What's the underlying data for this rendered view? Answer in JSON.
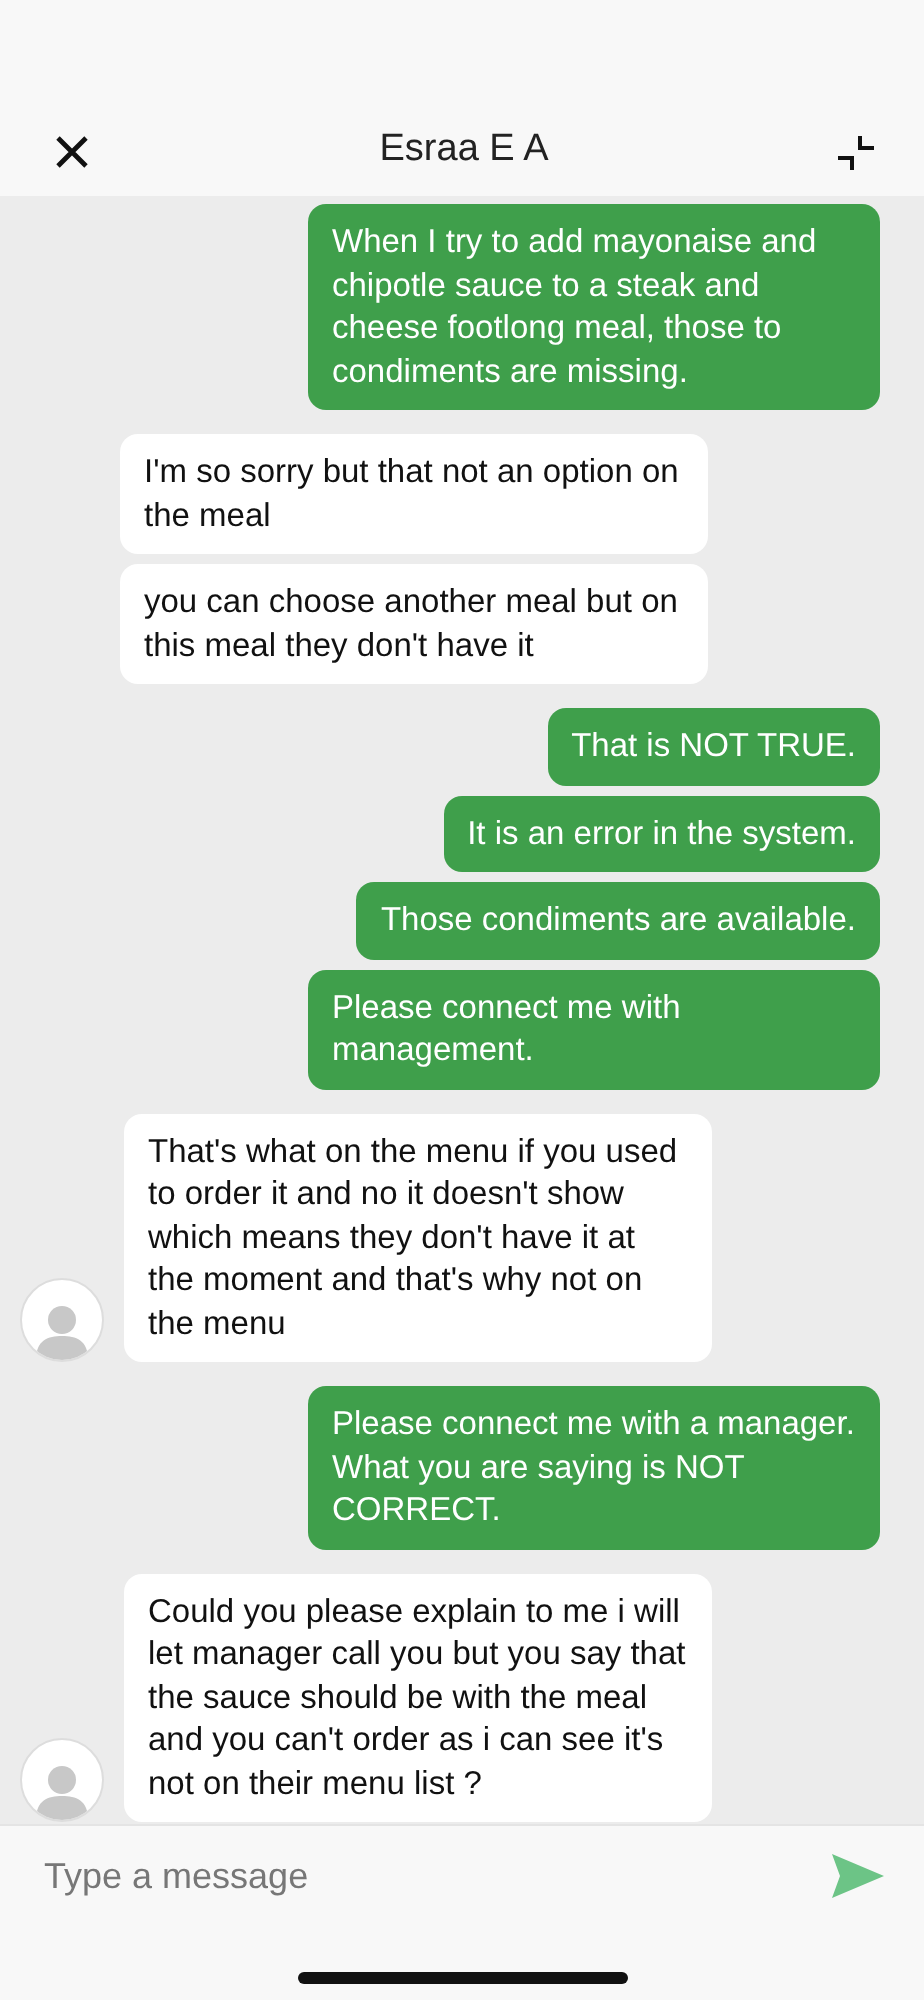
{
  "header": {
    "title": "Esraa E A"
  },
  "groups": [
    {
      "kind": "me",
      "avatar": false,
      "messages": [
        "When I try to add mayonaise and chipotle sauce to a steak and cheese footlong meal, those to condiments are missing."
      ]
    },
    {
      "kind": "agent",
      "avatar": false,
      "messages": [
        "I'm so sorry but that not an option on the meal",
        "you can choose another meal but on this meal they don't have it"
      ]
    },
    {
      "kind": "me",
      "avatar": false,
      "messages": [
        "That is NOT TRUE.",
        "It is an error in the system.",
        "Those condiments are available.",
        "Please connect me with management."
      ]
    },
    {
      "kind": "agent",
      "avatar": true,
      "messages": [
        "That's what on the menu if you used to order it and no it doesn't show which means they don't have it at the moment and that's why not on the menu"
      ]
    },
    {
      "kind": "me",
      "avatar": false,
      "messages": [
        "Please connect me with a manager. What you are saying is NOT CORRECT."
      ]
    },
    {
      "kind": "agent",
      "avatar": true,
      "messages": [
        "Could you please explain to me i will let manager call you but you say that the sauce should be with the meal and you can't order as i can see it's not on their menu list ?"
      ]
    }
  ],
  "composer": {
    "placeholder": "Type a message"
  }
}
